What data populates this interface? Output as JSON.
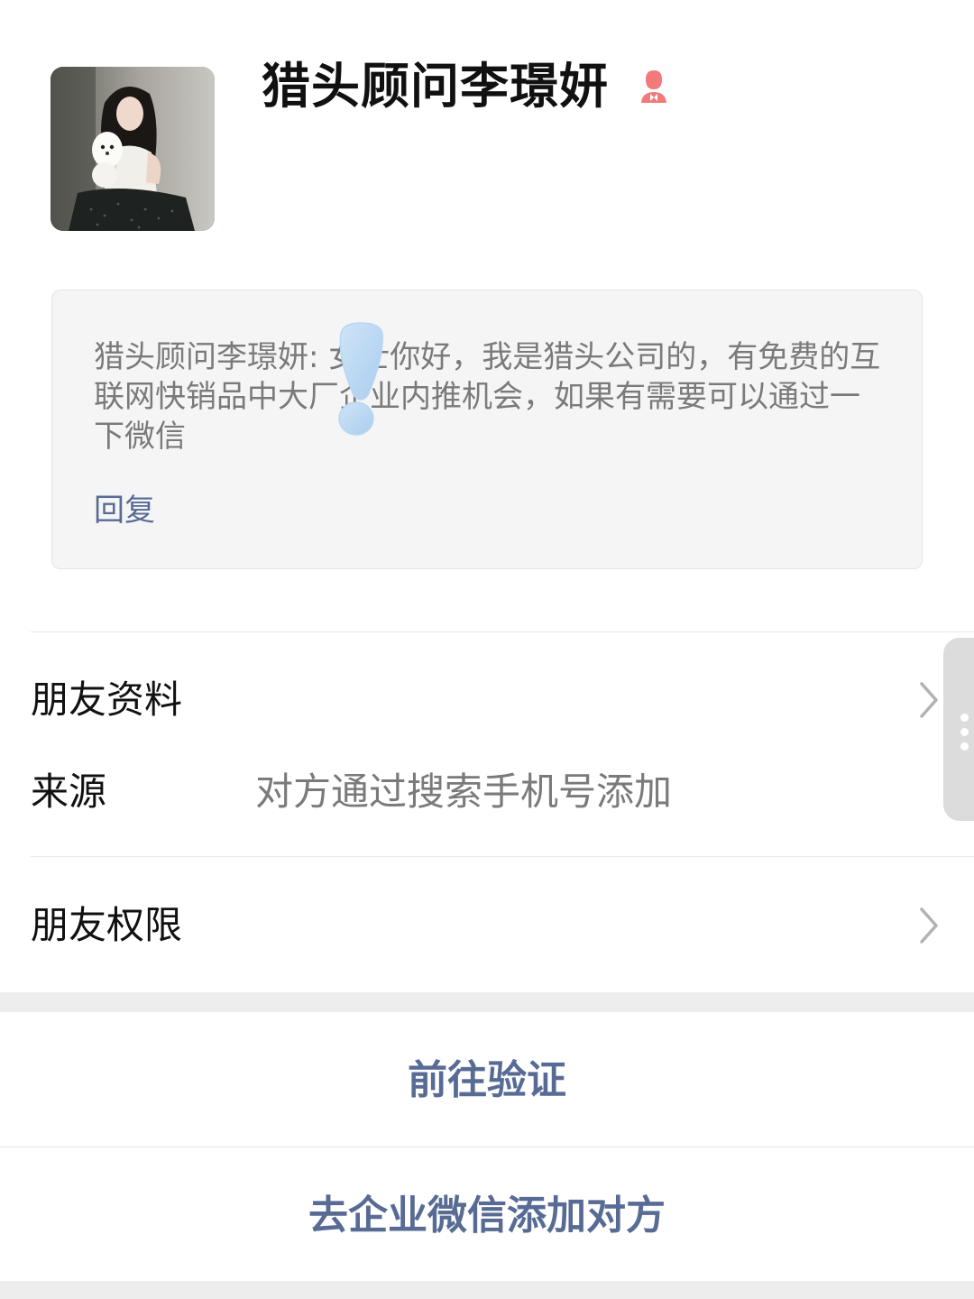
{
  "profile": {
    "name": "猎头顾问李璟妍",
    "avatar_icon": "profile-photo-woman-with-white-puppy",
    "gender_icon": "female-icon"
  },
  "message": {
    "text": "猎头顾问李璟妍: 女士你好，我是猎头公司的，有免费的互联网快销品中大厂企业内推机会，如果有需要可以通过一下微信",
    "reply_label": "回复",
    "sticker_icon": "exclamation-sticker"
  },
  "rows": {
    "friend_info_label": "朋友资料",
    "source_label": "来源",
    "source_value": "对方通过搜索手机号添加",
    "friend_permission_label": "朋友权限"
  },
  "actions": {
    "verify_label": "前往验证",
    "enterprise_add_label": "去企业微信添加对方"
  },
  "colors": {
    "link_blue": "#576b95",
    "gender_pink": "#f27a7a",
    "text_primary": "#111111",
    "text_secondary": "#7a7a7a",
    "card_bg": "#f5f5f5"
  }
}
